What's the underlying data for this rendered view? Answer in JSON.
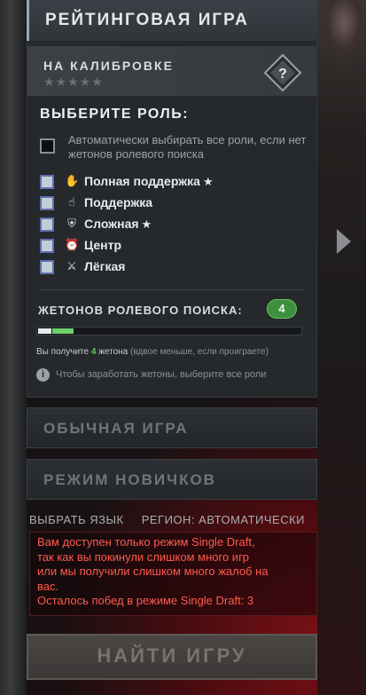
{
  "ranked": {
    "title": "РЕЙТИНГОВАЯ ИГРА"
  },
  "calibration": {
    "label": "НА КАЛИБРОВКЕ",
    "stars": "★★★★★",
    "rank_symbol": "?"
  },
  "roles": {
    "title": "ВЫБЕРИТЕ РОЛЬ:",
    "auto_select": {
      "checked": false,
      "text": "Автоматически выбирать все роли, если нет жетонов ролевого поиска"
    },
    "items": [
      {
        "label": "Полная поддержка",
        "icon": "full-support-icon",
        "starred": true,
        "checked": false
      },
      {
        "label": "Поддержка",
        "icon": "support-icon",
        "starred": false,
        "checked": false
      },
      {
        "label": "Сложная",
        "icon": "offlane-shield-icon",
        "starred": true,
        "checked": false
      },
      {
        "label": "Центр",
        "icon": "mid-lane-icon",
        "starred": false,
        "checked": false
      },
      {
        "label": "Лёгкая",
        "icon": "safe-lane-sword-icon",
        "starred": false,
        "checked": false
      }
    ]
  },
  "tokens": {
    "label": "ЖЕТОНОВ РОЛЕВОГО ПОИСКА:",
    "count": "4",
    "progress_white": 0.05,
    "progress_green": 0.08,
    "gain_prefix": "Вы получите",
    "gain_number": "4",
    "gain_word": "жетона",
    "gain_note": "(вдвое меньше, если проиграете)",
    "info": "Чтобы заработать жетоны, выберите все роли",
    "info_symbol": "i"
  },
  "modes": {
    "normal": "ОБЫЧНАЯ ИГРА",
    "newbie": "РЕЖИМ НОВИЧКОВ"
  },
  "footer": {
    "language": "ВЫБРАТЬ ЯЗЫК",
    "region": "РЕГИОН: АВТОМАТИЧЕСКИ"
  },
  "warning": {
    "lines": [
      "Вам доступен только режим Single Draft,",
      "так как вы покинули слишком много игр",
      "или мы получили слишком много жалоб на",
      "вас.",
      "Осталось побед в режиме Single Draft: 3"
    ]
  },
  "find_game": {
    "label": "НАЙТИ ИГРУ"
  },
  "colors": {
    "warning_text": "#ff5b4f",
    "token_badge": "#3e8f3f",
    "token_green": "#6ad06a"
  }
}
